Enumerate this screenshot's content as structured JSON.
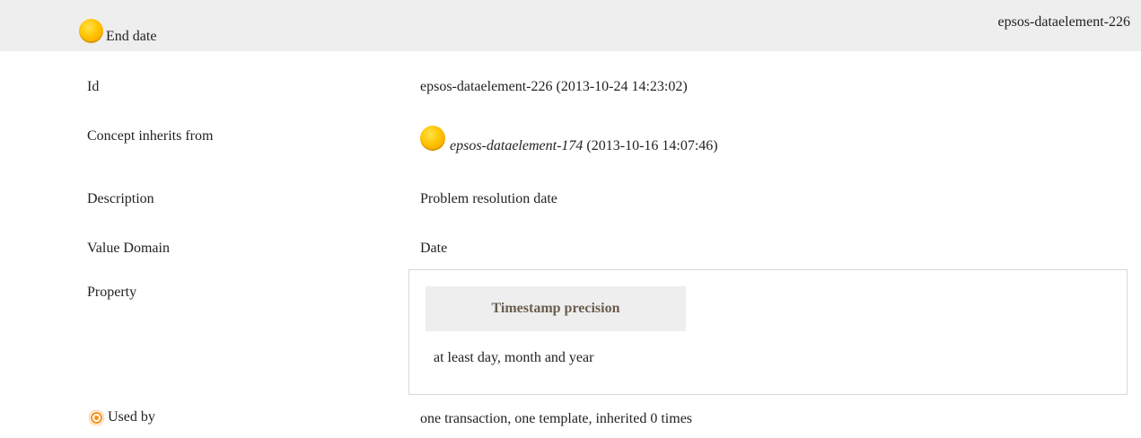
{
  "header": {
    "title": "End date",
    "ref": "epsos-dataelement-226",
    "icon": "concept-orb-icon"
  },
  "rows": {
    "id": {
      "label": "Id",
      "value": "epsos-dataelement-226 (2013-10-24 14:23:02)"
    },
    "inherits": {
      "label": "Concept inherits from",
      "ref": "epsos-dataelement-174",
      "date": "(2013-10-16 14:07:46)"
    },
    "description": {
      "label": "Description",
      "value": "Problem resolution date"
    },
    "value_domain": {
      "label": "Value Domain",
      "value": "Date"
    },
    "property": {
      "label": "Property",
      "name": "Timestamp precision",
      "text": "at least day, month and year"
    },
    "used_by": {
      "label": "Used by",
      "value": "one transaction, one template, inherited 0 times",
      "icon": "target-icon"
    }
  },
  "colors": {
    "header_bg": "#eeeeee",
    "orb": "#ffc400",
    "property_name": "#6a5d4d",
    "target": "#f7941d"
  }
}
